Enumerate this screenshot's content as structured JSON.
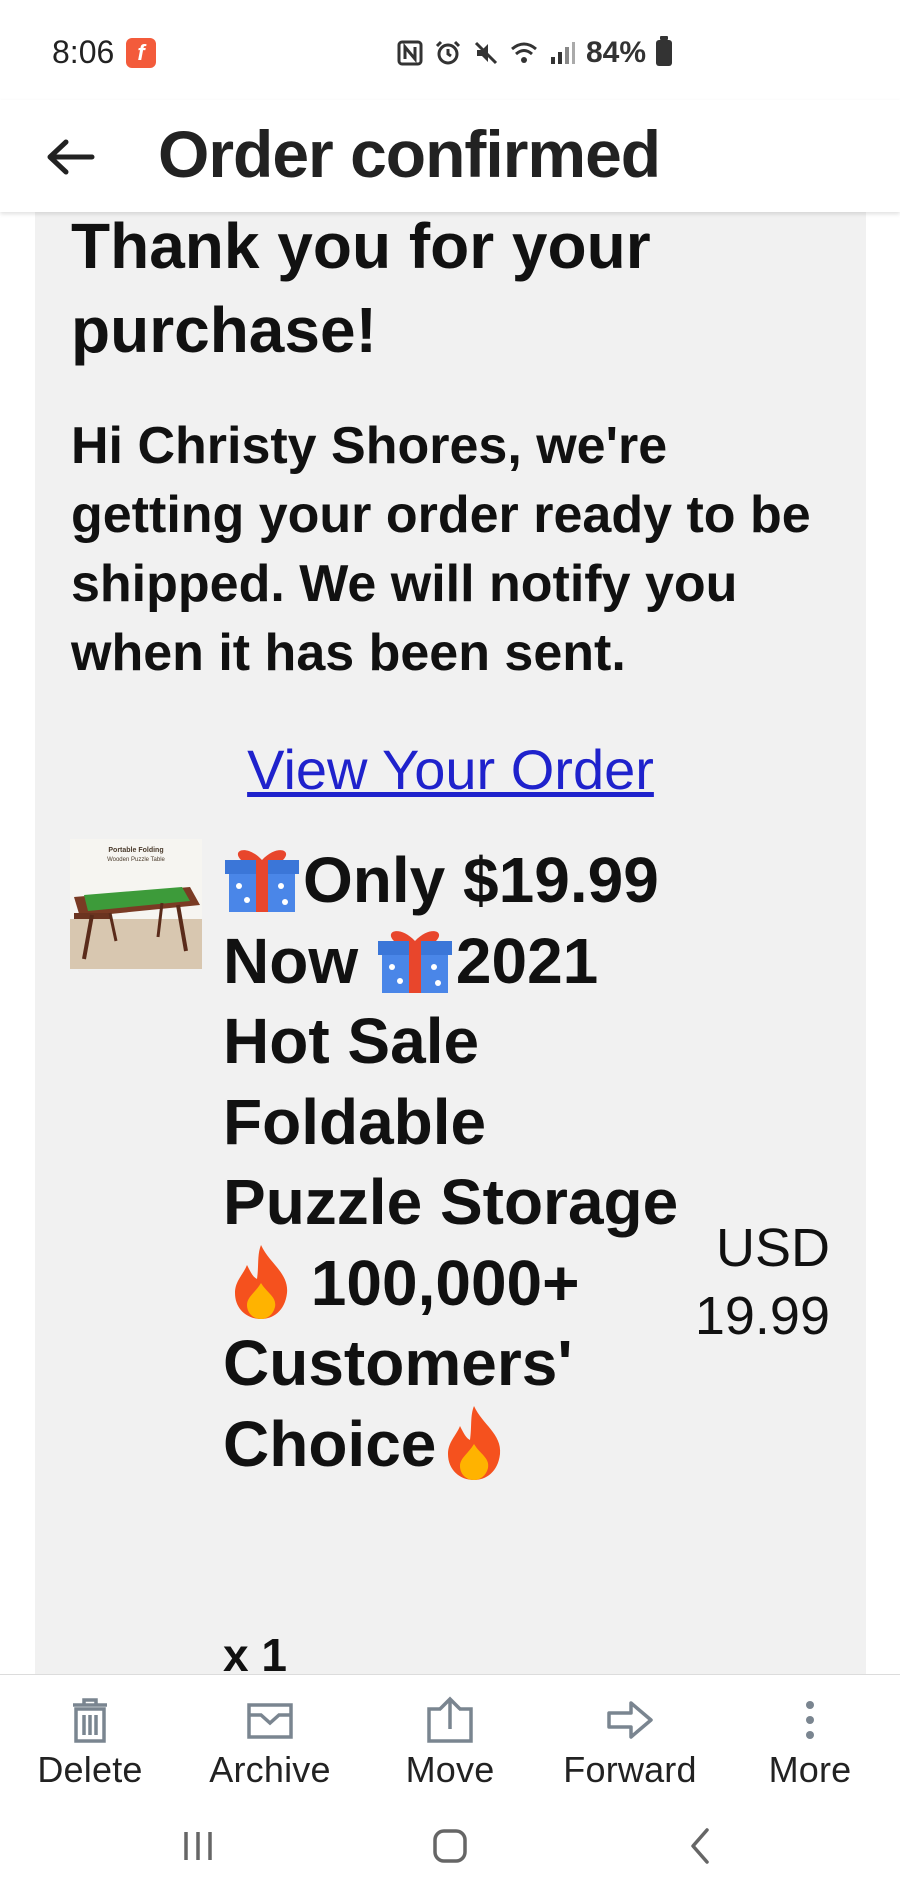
{
  "status_bar": {
    "time": "8:06",
    "battery": "84%",
    "notification_app_icon": "flipboard-icon",
    "icons": [
      "nfc-icon",
      "alarm-icon",
      "mute-icon",
      "wifi-icon",
      "signal-icon",
      "battery-icon"
    ]
  },
  "header": {
    "title": "Order confirmed",
    "back_icon": "back-arrow-icon"
  },
  "email": {
    "heading": "Thank you for your purchase!",
    "greeting": "Hi Christy Shores, we're getting your order ready to be shipped. We will notify you when it has been sent.",
    "view_order_link": "View Your Order",
    "link_color": "#1f22cc",
    "product": {
      "thumbnail_caption": "Portable Folding Wooden Puzzle Table",
      "title_part1": "Only $19.99 Now ",
      "title_part2": "2021 Hot Sale Foldable Puzzle Storage",
      "title_part3": " 100,000+ Customers' Choice",
      "price_currency": "USD",
      "price_value": "19.99",
      "quantity": "x 1"
    }
  },
  "toolbar": {
    "items": [
      {
        "label": "Delete",
        "icon": "trash-icon"
      },
      {
        "label": "Archive",
        "icon": "archive-icon"
      },
      {
        "label": "Move",
        "icon": "move-icon"
      },
      {
        "label": "Forward",
        "icon": "forward-icon"
      },
      {
        "label": "More",
        "icon": "more-vertical-icon"
      }
    ]
  },
  "nav_bar": {
    "buttons": [
      "recents-icon",
      "home-icon",
      "back-icon"
    ]
  }
}
